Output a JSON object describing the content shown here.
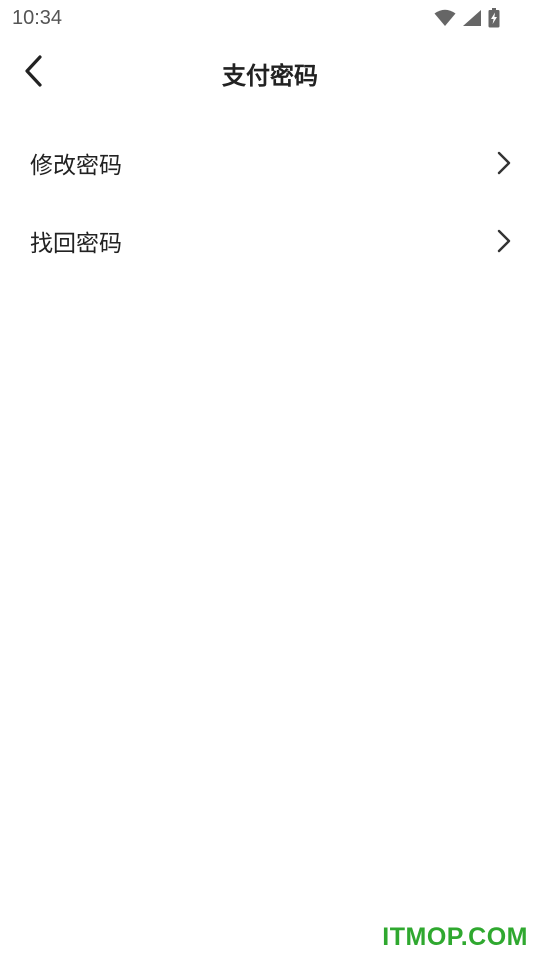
{
  "status_bar": {
    "time": "10:34",
    "icons": [
      "wifi-icon",
      "signal-icon",
      "battery-charging-icon"
    ]
  },
  "header": {
    "title": "支付密码",
    "back_icon": "chevron-left-icon"
  },
  "menu": {
    "items": [
      {
        "label": "修改密码",
        "icon": "chevron-right-icon"
      },
      {
        "label": "找回密码",
        "icon": "chevron-right-icon"
      }
    ]
  },
  "watermark": {
    "text": "ITMOP.COM",
    "color": "#2fa82f"
  },
  "colors": {
    "background": "#ffffff",
    "text": "#222222",
    "status_text": "#555555"
  }
}
